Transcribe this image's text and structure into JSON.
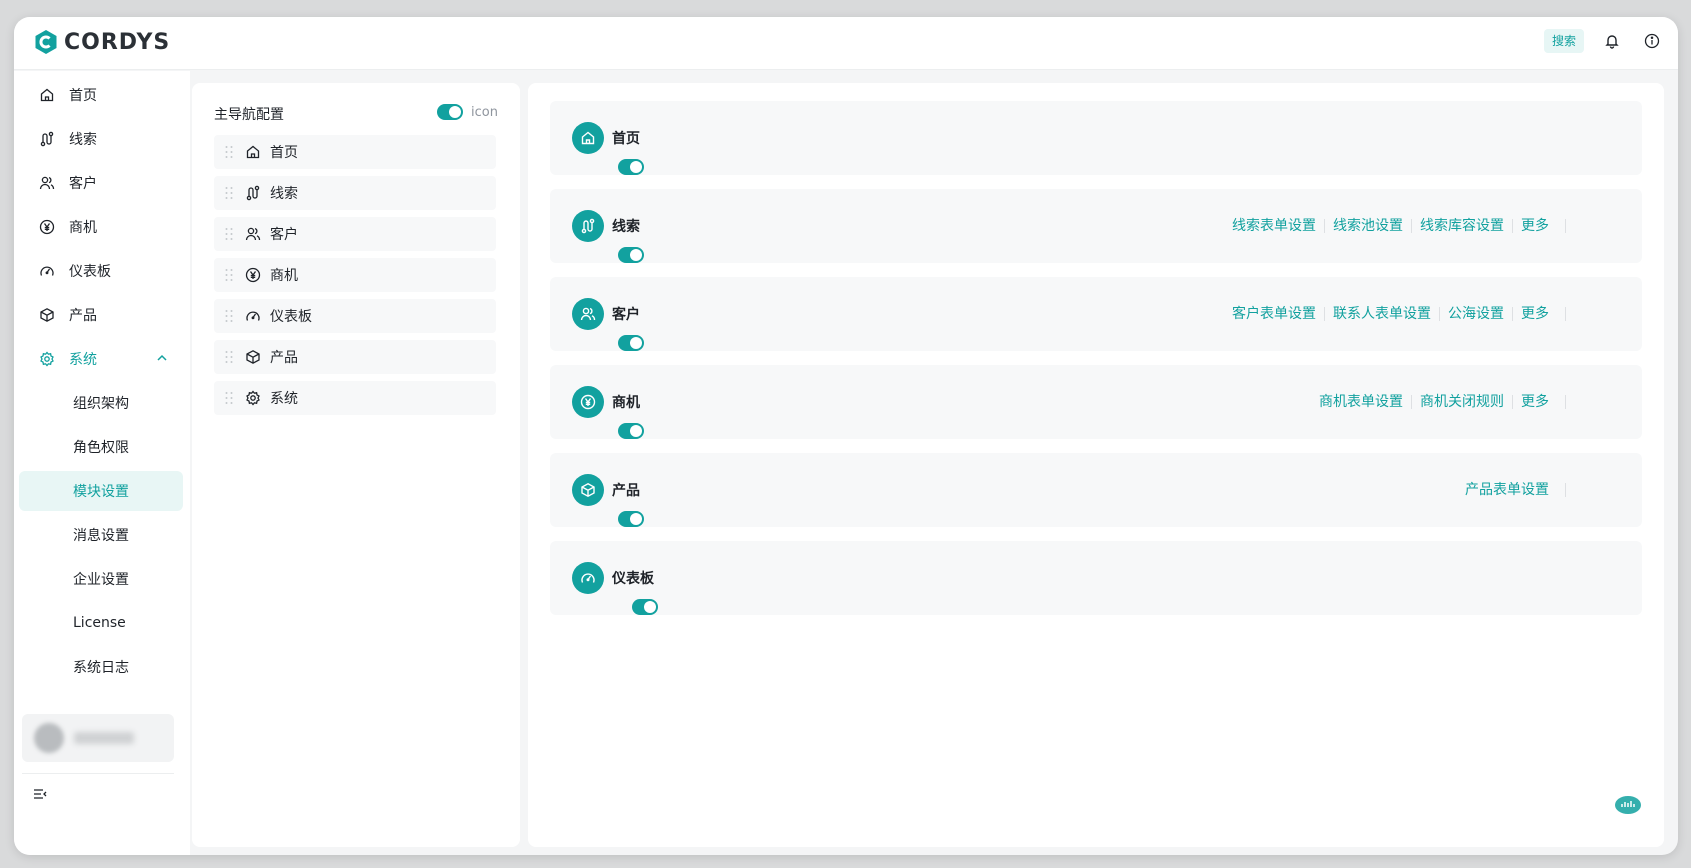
{
  "app": {
    "logo_text": "CORDYS",
    "brand_color": "#12a19f"
  },
  "topbar": {
    "search_label": "搜索",
    "bell_icon": "bell-icon",
    "info_icon": "info-icon"
  },
  "sidebar": {
    "items": [
      {
        "label": "首页",
        "icon": "home-icon"
      },
      {
        "label": "线索",
        "icon": "route-icon"
      },
      {
        "label": "客户",
        "icon": "users-icon"
      },
      {
        "label": "商机",
        "icon": "yen-icon"
      },
      {
        "label": "仪表板",
        "icon": "gauge-icon"
      },
      {
        "label": "产品",
        "icon": "box-icon"
      },
      {
        "label": "系统",
        "icon": "gear-icon",
        "expanded": true
      }
    ],
    "sub_items": [
      {
        "label": "组织架构"
      },
      {
        "label": "角色权限"
      },
      {
        "label": "模块设置",
        "selected": true
      },
      {
        "label": "消息设置"
      },
      {
        "label": "企业设置"
      },
      {
        "label": "License"
      },
      {
        "label": "系统日志"
      }
    ]
  },
  "nav_config": {
    "title": "主导航配置",
    "icon_toggle_label": "icon",
    "icon_toggle_on": true,
    "items": [
      {
        "label": "首页",
        "icon": "home-icon"
      },
      {
        "label": "线索",
        "icon": "route-icon"
      },
      {
        "label": "客户",
        "icon": "users-icon"
      },
      {
        "label": "商机",
        "icon": "yen-icon"
      },
      {
        "label": "仪表板",
        "icon": "gauge-icon"
      },
      {
        "label": "产品",
        "icon": "box-icon"
      },
      {
        "label": "系统",
        "icon": "gear-icon"
      }
    ]
  },
  "modules": [
    {
      "name": "首页",
      "icon": "home-icon",
      "links": [],
      "enabled": true
    },
    {
      "name": "线索",
      "icon": "route-icon",
      "links": [
        "线索表单设置",
        "线索池设置",
        "线索库容设置",
        "更多"
      ],
      "enabled": true
    },
    {
      "name": "客户",
      "icon": "users-icon",
      "links": [
        "客户表单设置",
        "联系人表单设置",
        "公海设置",
        "更多"
      ],
      "enabled": true
    },
    {
      "name": "商机",
      "icon": "yen-icon",
      "links": [
        "商机表单设置",
        "商机关闭规则",
        "更多"
      ],
      "enabled": true
    },
    {
      "name": "产品",
      "icon": "box-icon",
      "links": [
        "产品表单设置"
      ],
      "enabled": true
    },
    {
      "name": "仪表板",
      "icon": "gauge-icon",
      "links": [],
      "enabled": true
    }
  ]
}
